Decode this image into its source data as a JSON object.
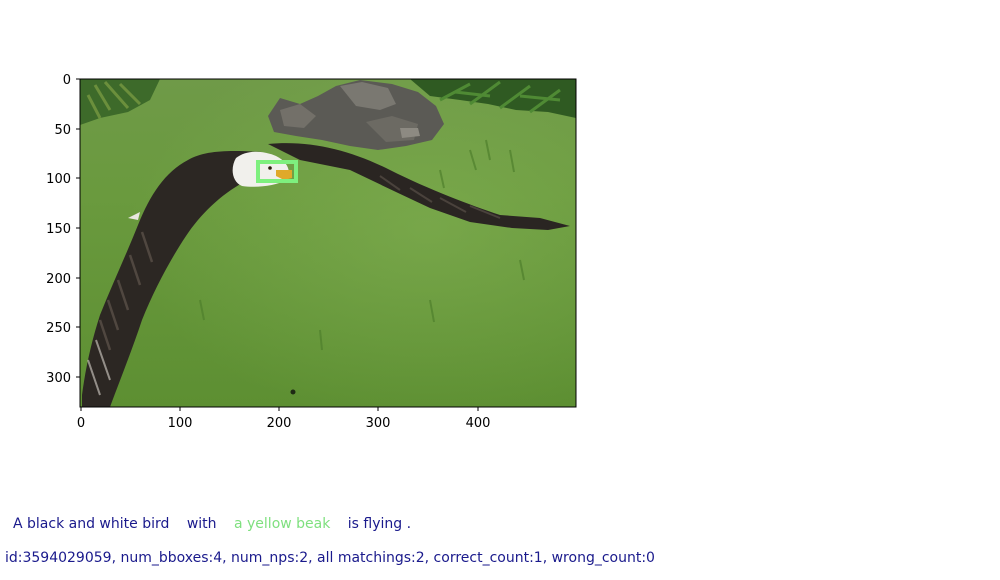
{
  "image": {
    "description": "photo",
    "x_ticks": [
      "0",
      "100",
      "200",
      "300",
      "400"
    ],
    "y_ticks": [
      "0",
      "50",
      "100",
      "150",
      "200",
      "250",
      "300"
    ],
    "box_color": "#7ef07e"
  },
  "caption": {
    "part1": "A black and white bird",
    "part2": "with",
    "part3": "a yellow beak",
    "part4": "is flying ."
  },
  "info": "id:3594029059, num_bboxes:4, num_nps:2, all matchings:2, correct_count:1, wrong_count:0"
}
